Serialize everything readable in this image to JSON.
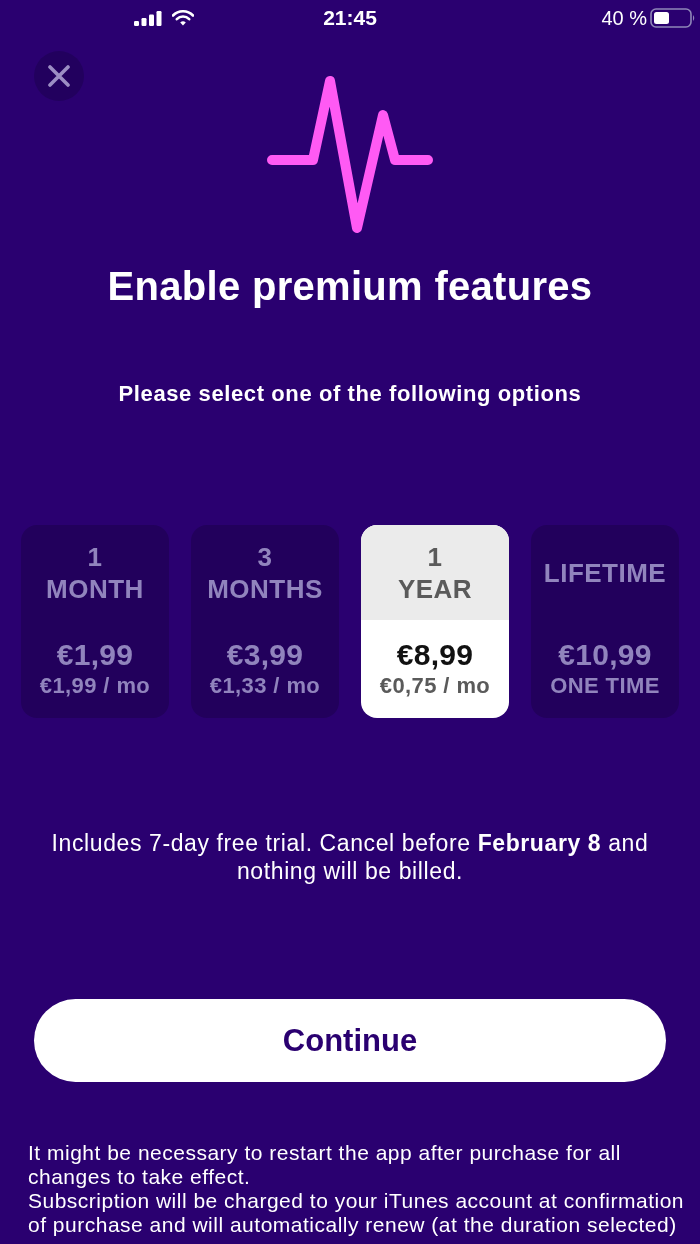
{
  "status_bar": {
    "time": "21:45",
    "battery": "40 %"
  },
  "title": "Enable premium features",
  "subtitle": "Please select one of the following options",
  "plans": [
    {
      "period": "1\nMONTH",
      "price": "€1,99",
      "per_month": "€1,99 / mo",
      "selected": false
    },
    {
      "period": "3\nMONTHS",
      "price": "€3,99",
      "per_month": "€1,33 / mo",
      "selected": false
    },
    {
      "period": "1\nYEAR",
      "price": "€8,99",
      "per_month": "€0,75 / mo",
      "selected": true
    },
    {
      "period": "LIFETIME",
      "price": "€10,99",
      "per_month": "ONE TIME",
      "selected": false
    }
  ],
  "trial_note": "Includes 7-day free trial. Cancel before **February 8** and nothing will be billed.",
  "continue_button": "Continue",
  "footer": [
    "It might be necessary to restart the app after purchase for all changes to take effect.",
    "Subscription will be charged to your iTunes account at confirmation of purchase and will automatically renew (at the duration selected)"
  ]
}
